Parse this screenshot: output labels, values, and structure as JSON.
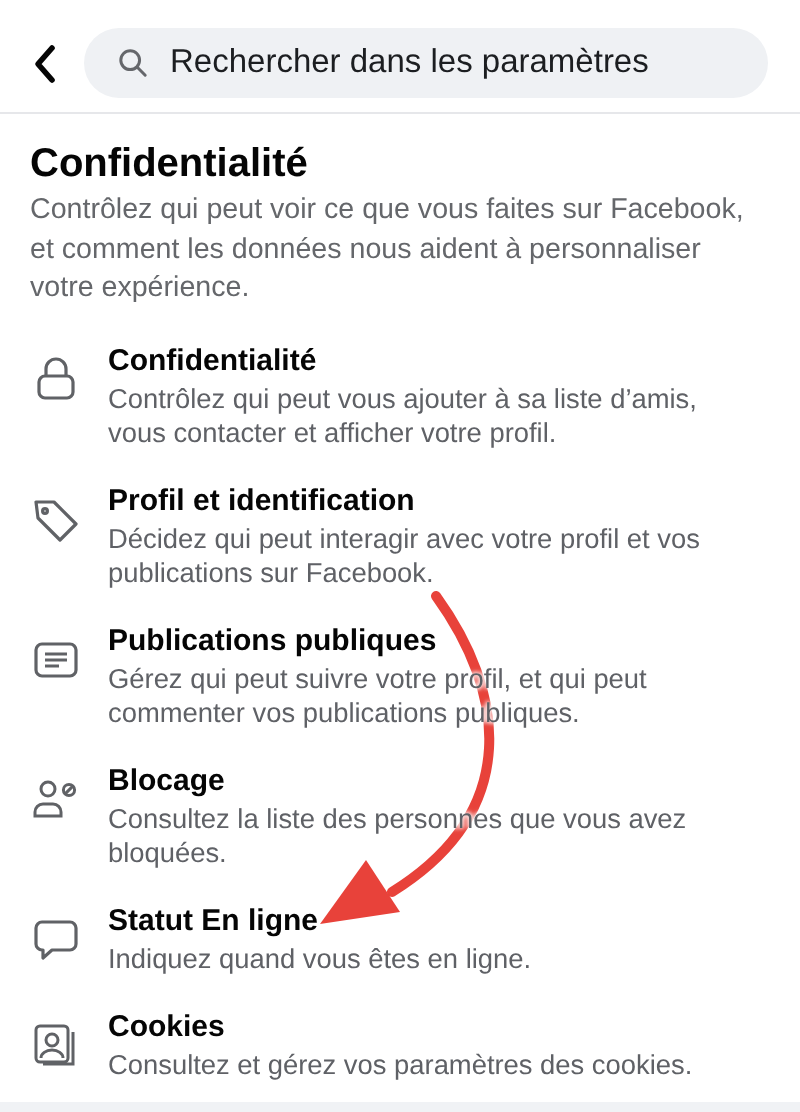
{
  "search": {
    "placeholder": "Rechercher dans les paramètres"
  },
  "section": {
    "title": "Confidentialité",
    "description": "Contrôlez qui peut voir ce que vous faites sur Facebook, et comment les données nous aident à personnaliser votre expérience."
  },
  "items": [
    {
      "title": "Confidentialité",
      "description": "Contrôlez qui peut vous ajouter à sa liste d’amis, vous contacter et afficher votre profil."
    },
    {
      "title": "Profil et identification",
      "description": "Décidez qui peut interagir avec votre profil et vos publications sur Facebook."
    },
    {
      "title": "Publications publiques",
      "description": "Gérez qui peut suivre votre profil, et qui peut commenter vos publications publiques."
    },
    {
      "title": "Blocage",
      "description": "Consultez la liste des personnes que vous avez bloquées."
    },
    {
      "title": "Statut En ligne",
      "description": "Indiquez quand vous êtes en ligne."
    },
    {
      "title": "Cookies",
      "description": "Consultez et gérez vos paramètres des cookies."
    }
  ]
}
